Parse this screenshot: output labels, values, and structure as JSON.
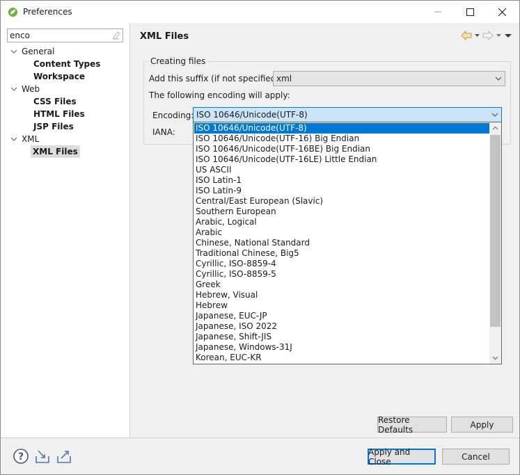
{
  "window": {
    "title": "Preferences",
    "app_icon": "spring-leaf-icon"
  },
  "filter": {
    "value": "enco",
    "clear_icon": "eraser-icon"
  },
  "tree": {
    "general": {
      "label": "General",
      "children": [
        "Content Types",
        "Workspace"
      ]
    },
    "web": {
      "label": "Web",
      "children": [
        "CSS Files",
        "HTML Files",
        "JSP Files"
      ]
    },
    "xml": {
      "label": "XML",
      "children": [
        "XML Files"
      ]
    }
  },
  "page": {
    "title": "XML Files",
    "group_label": "Creating files",
    "suffix_label": "Add this suffix (if not specified):",
    "suffix_value": "xml",
    "encoding_note": "The following encoding will apply:",
    "encoding_label": "Encoding:",
    "encoding_value": "ISO 10646/Unicode(UTF-8)",
    "iana_label": "IANA:"
  },
  "encoding_options": [
    "ISO 10646/Unicode(UTF-8)",
    "ISO 10646/Unicode(UTF-16) Big Endian",
    "ISO 10646/Unicode(UTF-16BE) Big Endian",
    "ISO 10646/Unicode(UTF-16LE) Little Endian",
    "US ASCII",
    "ISO Latin-1",
    "ISO Latin-9",
    "Central/East European (Slavic)",
    "Southern European",
    "Arabic, Logical",
    "Arabic",
    "Chinese, National Standard",
    "Traditional Chinese, Big5",
    "Cyrillic, ISO-8859-4",
    "Cyrillic, ISO-8859-5",
    "Greek",
    "Hebrew, Visual",
    "Hebrew",
    "Japanese, EUC-JP",
    "Japanese, ISO 2022",
    "Japanese, Shift-JIS",
    "Japanese, Windows-31J",
    "Korean, EUC-KR"
  ],
  "buttons": {
    "restore_defaults": "Restore Defaults",
    "apply": "Apply",
    "apply_and_close": "Apply and Close",
    "cancel": "Cancel"
  },
  "colors": {
    "selection": "#0078d7",
    "focused_combo": "#cce4f7",
    "spring_green": "#6db33f"
  }
}
